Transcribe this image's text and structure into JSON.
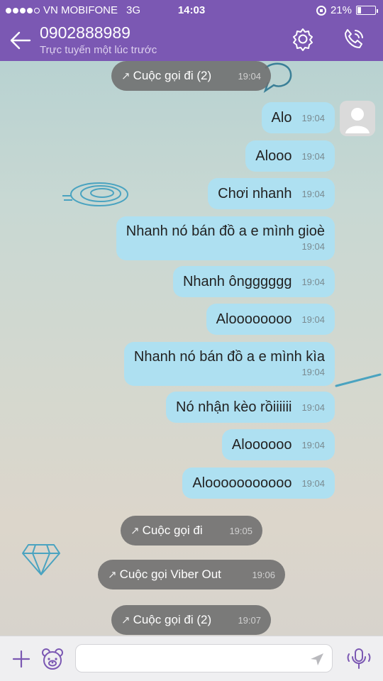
{
  "status_bar": {
    "carrier": "VN MOBIFONE",
    "network": "3G",
    "time": "14:03",
    "battery": "21%",
    "battery_level": 0.21,
    "signal_bars": 4,
    "signal_max": 5
  },
  "header": {
    "contact_name": "0902888989",
    "contact_status": "Trực tuyến một lúc trước",
    "back_icon": "arrow-left-icon",
    "settings_icon": "gear-icon",
    "call_icon": "phone-call-icon",
    "bg_color": "#7b58b3"
  },
  "messages": [
    {
      "type": "call",
      "text": "Cuộc gọi đi (2)",
      "time": "19:04"
    },
    {
      "type": "out",
      "text": "Alo",
      "time": "19:04"
    },
    {
      "type": "out",
      "text": "Alooo",
      "time": "19:04"
    },
    {
      "type": "out",
      "text": "Chơi nhanh",
      "time": "19:04"
    },
    {
      "type": "out",
      "text": "Nhanh nó bán đồ a e mình gioè",
      "time": "19:04"
    },
    {
      "type": "out",
      "text": "Nhanh ôngggggg",
      "time": "19:04"
    },
    {
      "type": "out",
      "text": "Aloooooooo",
      "time": "19:04"
    },
    {
      "type": "out",
      "text": "Nhanh nó bán đồ a e mình kìa",
      "time": "19:04"
    },
    {
      "type": "out",
      "text": "Nó nhận kèo rồiiiiii",
      "time": "19:04"
    },
    {
      "type": "out",
      "text": "Aloooooo",
      "time": "19:04"
    },
    {
      "type": "out",
      "text": "Alooooooooooo",
      "time": "19:04"
    },
    {
      "type": "call",
      "text": "Cuộc gọi đi",
      "time": "19:05"
    },
    {
      "type": "call",
      "text": "Cuộc gọi Viber Out",
      "time": "19:06"
    },
    {
      "type": "call",
      "text": "Cuộc gọi đi (2)",
      "time": "19:07"
    }
  ],
  "input_bar": {
    "placeholder": "",
    "plus_icon": "plus-icon",
    "sticker_icon": "bear-sticker-icon",
    "send_icon": "send-icon",
    "mic_icon": "microphone-icon"
  },
  "colors": {
    "bubble_out": "#aee0f1",
    "call_pill": "#707070",
    "accent": "#7b58b3"
  }
}
